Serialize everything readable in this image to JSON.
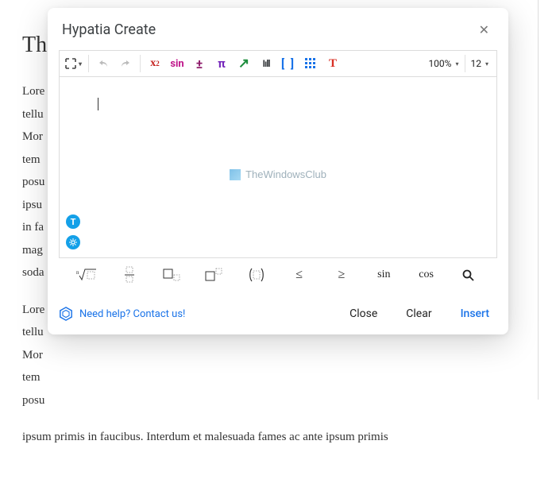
{
  "doc": {
    "title_partial": "Th",
    "para1_partial": "Lore\ntellu\nMor\ntem\nposu\nipsu\nin fa\nmag\nsoda",
    "para2_partial": "Lore\ntellu\nMor\ntem\nposu",
    "para3": "ipsum primis in faucibus. Interdum et malesuada fames ac ante ipsum primis"
  },
  "modal": {
    "title": "Hypatia Create",
    "toolbar": {
      "x2": "x",
      "x2_sup": "2",
      "sin": "sin",
      "pm": "±",
      "pi": "π",
      "arrow": "↗",
      "bars": "Iıll",
      "brackets": "[ ]",
      "T": "T"
    },
    "zoom": "100%",
    "font_size": "12",
    "watermark": "TheWindowsClub",
    "palette": {
      "root": "ⁿ√□",
      "frac": "▫⁄▫",
      "sub": "□▫",
      "sup": "□▫",
      "paren": "(▫)",
      "le": "≤",
      "ge": "≥",
      "sin": "sin",
      "cos": "cos"
    },
    "help": "Need help? Contact us!",
    "buttons": {
      "close": "Close",
      "clear": "Clear",
      "insert": "Insert"
    }
  }
}
